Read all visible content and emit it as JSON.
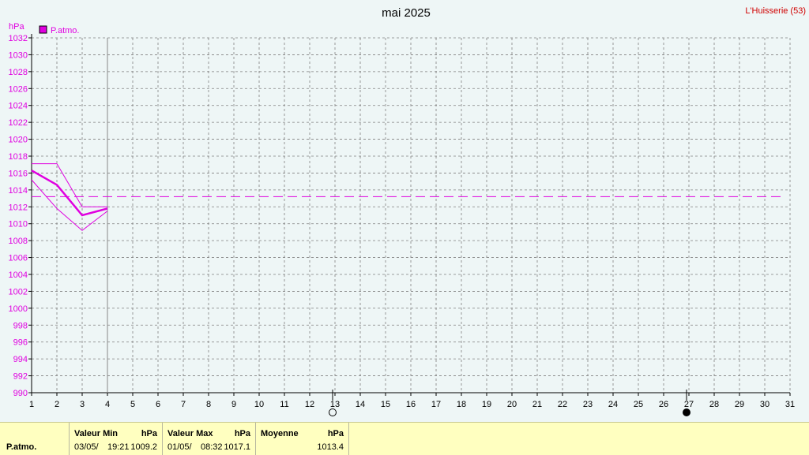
{
  "chart_data": {
    "type": "line",
    "title": "mai 2025",
    "station": "L'Huisserie (53)",
    "ylabel": "hPa",
    "ylim": [
      990,
      1032
    ],
    "xlim": [
      1,
      31
    ],
    "x_ticks": [
      1,
      2,
      3,
      4,
      5,
      6,
      7,
      8,
      9,
      10,
      11,
      12,
      13,
      14,
      15,
      16,
      17,
      18,
      19,
      20,
      21,
      22,
      23,
      24,
      25,
      26,
      27,
      28,
      29,
      30,
      31
    ],
    "y_ticks": [
      990,
      992,
      994,
      996,
      998,
      1000,
      1002,
      1004,
      1006,
      1008,
      1010,
      1012,
      1014,
      1016,
      1018,
      1020,
      1022,
      1024,
      1026,
      1028,
      1030,
      1032
    ],
    "legend": [
      {
        "name": "P.atmo.",
        "color": "#e000e0"
      }
    ],
    "grid": true,
    "current_day_marker": 4,
    "moon_phases": [
      {
        "day": 13,
        "phase": "full-moon"
      },
      {
        "day": 27,
        "phase": "new-moon"
      }
    ],
    "series": [
      {
        "name": "P.atmo.",
        "role": "mean",
        "x": [
          1,
          2,
          3,
          4
        ],
        "y": [
          1016.3,
          1014.6,
          1011.0,
          1011.8
        ]
      },
      {
        "name": "P.atmo.",
        "role": "max",
        "x": [
          1,
          2,
          3,
          4
        ],
        "y": [
          1017.1,
          1017.1,
          1012.0,
          1012.0
        ]
      },
      {
        "name": "P.atmo.",
        "role": "min",
        "x": [
          1,
          2,
          3,
          4
        ],
        "y": [
          1015.2,
          1011.8,
          1009.2,
          1011.5
        ]
      }
    ],
    "average_line": 1013.2
  },
  "stats": {
    "row_label": "P.atmo.",
    "min": {
      "header": "Valeur Min",
      "unit": "hPa",
      "date": "03/05/",
      "time": "19:21",
      "value": "1009.2"
    },
    "max": {
      "header": "Valeur Max",
      "unit": "hPa",
      "date": "01/05/",
      "time": "08:32",
      "value": "1017.1"
    },
    "avg": {
      "header": "Moyenne",
      "unit": "hPa",
      "value": "1013.4"
    }
  },
  "colors": {
    "series": "#e000e0",
    "grid": "#808080",
    "axis": "#000000",
    "background": "#eef6f6",
    "table": "#ffffc0"
  }
}
